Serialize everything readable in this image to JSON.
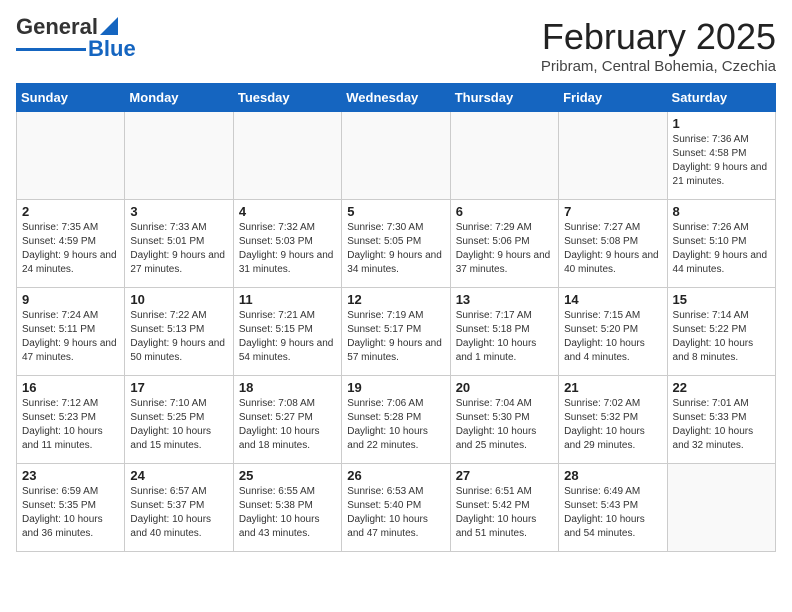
{
  "header": {
    "logo_line1": "General",
    "logo_line2": "Blue",
    "month_year": "February 2025",
    "location": "Pribram, Central Bohemia, Czechia"
  },
  "weekdays": [
    "Sunday",
    "Monday",
    "Tuesday",
    "Wednesday",
    "Thursday",
    "Friday",
    "Saturday"
  ],
  "weeks": [
    [
      {
        "day": "",
        "info": ""
      },
      {
        "day": "",
        "info": ""
      },
      {
        "day": "",
        "info": ""
      },
      {
        "day": "",
        "info": ""
      },
      {
        "day": "",
        "info": ""
      },
      {
        "day": "",
        "info": ""
      },
      {
        "day": "1",
        "info": "Sunrise: 7:36 AM\nSunset: 4:58 PM\nDaylight: 9 hours and 21 minutes."
      }
    ],
    [
      {
        "day": "2",
        "info": "Sunrise: 7:35 AM\nSunset: 4:59 PM\nDaylight: 9 hours and 24 minutes."
      },
      {
        "day": "3",
        "info": "Sunrise: 7:33 AM\nSunset: 5:01 PM\nDaylight: 9 hours and 27 minutes."
      },
      {
        "day": "4",
        "info": "Sunrise: 7:32 AM\nSunset: 5:03 PM\nDaylight: 9 hours and 31 minutes."
      },
      {
        "day": "5",
        "info": "Sunrise: 7:30 AM\nSunset: 5:05 PM\nDaylight: 9 hours and 34 minutes."
      },
      {
        "day": "6",
        "info": "Sunrise: 7:29 AM\nSunset: 5:06 PM\nDaylight: 9 hours and 37 minutes."
      },
      {
        "day": "7",
        "info": "Sunrise: 7:27 AM\nSunset: 5:08 PM\nDaylight: 9 hours and 40 minutes."
      },
      {
        "day": "8",
        "info": "Sunrise: 7:26 AM\nSunset: 5:10 PM\nDaylight: 9 hours and 44 minutes."
      }
    ],
    [
      {
        "day": "9",
        "info": "Sunrise: 7:24 AM\nSunset: 5:11 PM\nDaylight: 9 hours and 47 minutes."
      },
      {
        "day": "10",
        "info": "Sunrise: 7:22 AM\nSunset: 5:13 PM\nDaylight: 9 hours and 50 minutes."
      },
      {
        "day": "11",
        "info": "Sunrise: 7:21 AM\nSunset: 5:15 PM\nDaylight: 9 hours and 54 minutes."
      },
      {
        "day": "12",
        "info": "Sunrise: 7:19 AM\nSunset: 5:17 PM\nDaylight: 9 hours and 57 minutes."
      },
      {
        "day": "13",
        "info": "Sunrise: 7:17 AM\nSunset: 5:18 PM\nDaylight: 10 hours and 1 minute."
      },
      {
        "day": "14",
        "info": "Sunrise: 7:15 AM\nSunset: 5:20 PM\nDaylight: 10 hours and 4 minutes."
      },
      {
        "day": "15",
        "info": "Sunrise: 7:14 AM\nSunset: 5:22 PM\nDaylight: 10 hours and 8 minutes."
      }
    ],
    [
      {
        "day": "16",
        "info": "Sunrise: 7:12 AM\nSunset: 5:23 PM\nDaylight: 10 hours and 11 minutes."
      },
      {
        "day": "17",
        "info": "Sunrise: 7:10 AM\nSunset: 5:25 PM\nDaylight: 10 hours and 15 minutes."
      },
      {
        "day": "18",
        "info": "Sunrise: 7:08 AM\nSunset: 5:27 PM\nDaylight: 10 hours and 18 minutes."
      },
      {
        "day": "19",
        "info": "Sunrise: 7:06 AM\nSunset: 5:28 PM\nDaylight: 10 hours and 22 minutes."
      },
      {
        "day": "20",
        "info": "Sunrise: 7:04 AM\nSunset: 5:30 PM\nDaylight: 10 hours and 25 minutes."
      },
      {
        "day": "21",
        "info": "Sunrise: 7:02 AM\nSunset: 5:32 PM\nDaylight: 10 hours and 29 minutes."
      },
      {
        "day": "22",
        "info": "Sunrise: 7:01 AM\nSunset: 5:33 PM\nDaylight: 10 hours and 32 minutes."
      }
    ],
    [
      {
        "day": "23",
        "info": "Sunrise: 6:59 AM\nSunset: 5:35 PM\nDaylight: 10 hours and 36 minutes."
      },
      {
        "day": "24",
        "info": "Sunrise: 6:57 AM\nSunset: 5:37 PM\nDaylight: 10 hours and 40 minutes."
      },
      {
        "day": "25",
        "info": "Sunrise: 6:55 AM\nSunset: 5:38 PM\nDaylight: 10 hours and 43 minutes."
      },
      {
        "day": "26",
        "info": "Sunrise: 6:53 AM\nSunset: 5:40 PM\nDaylight: 10 hours and 47 minutes."
      },
      {
        "day": "27",
        "info": "Sunrise: 6:51 AM\nSunset: 5:42 PM\nDaylight: 10 hours and 51 minutes."
      },
      {
        "day": "28",
        "info": "Sunrise: 6:49 AM\nSunset: 5:43 PM\nDaylight: 10 hours and 54 minutes."
      },
      {
        "day": "",
        "info": ""
      }
    ]
  ]
}
